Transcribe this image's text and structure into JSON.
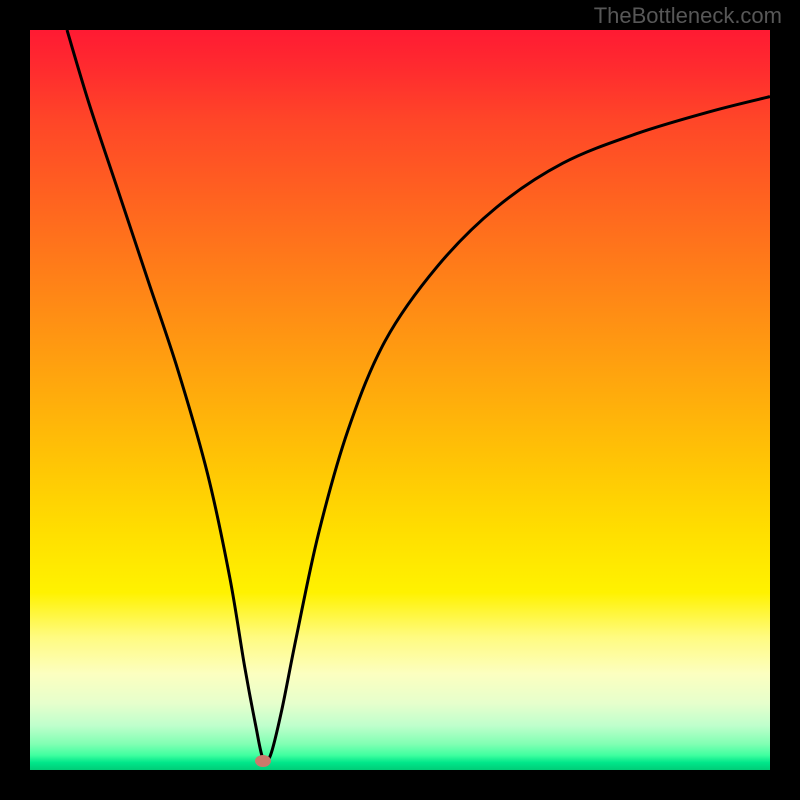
{
  "watermark": "TheBottleneck.com",
  "chart_data": {
    "type": "line",
    "title": "",
    "xlabel": "",
    "ylabel": "",
    "xlim": [
      0,
      100
    ],
    "ylim": [
      0,
      100
    ],
    "grid": false,
    "series": [
      {
        "name": "bottleneck-curve",
        "x": [
          5,
          8,
          12,
          16,
          20,
          24,
          27,
          29,
          30.5,
          31.5,
          32.5,
          34,
          36,
          39,
          43,
          48,
          55,
          63,
          72,
          82,
          92,
          100
        ],
        "y": [
          100,
          90,
          78,
          66,
          54,
          40,
          26,
          14,
          6,
          1.5,
          2,
          8,
          18,
          32,
          46,
          58,
          68,
          76,
          82,
          86,
          89,
          91
        ]
      }
    ],
    "marker": {
      "x": 31.5,
      "y": 1.2,
      "color": "#c97a6b"
    },
    "gradient_colors": {
      "top": "#ff1a33",
      "mid": "#ffdf00",
      "bottom": "#00cc77"
    }
  }
}
